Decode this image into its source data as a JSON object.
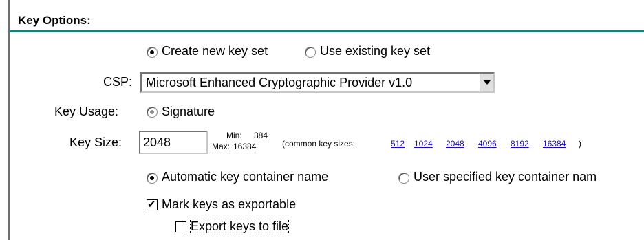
{
  "section_title": "Key Options:",
  "keyset": {
    "create_label": "Create new key set",
    "use_label": "Use existing key set",
    "selected": "create"
  },
  "csp": {
    "label": "CSP:",
    "value": "Microsoft Enhanced Cryptographic Provider v1.0"
  },
  "key_usage": {
    "label": "Key Usage:",
    "option": "Signature"
  },
  "key_size": {
    "label": "Key Size:",
    "value": "2048",
    "min_label": "Min:",
    "min_value": "384",
    "max_label": "Max:",
    "max_value": "16384",
    "common_prefix": "(common key sizes:",
    "common_suffix": ")",
    "common_sizes": [
      "512",
      "1024",
      "2048",
      "4096",
      "8192",
      "16384"
    ]
  },
  "container": {
    "auto_label": "Automatic key container name",
    "user_label": "User specified key container nam",
    "selected": "auto"
  },
  "exportable": {
    "label": "Mark keys as exportable",
    "checked": true
  },
  "export_file": {
    "label": "Export keys to file",
    "checked": false
  },
  "colors": {
    "rule": "#1f7d79",
    "link": "#1a0dab"
  }
}
